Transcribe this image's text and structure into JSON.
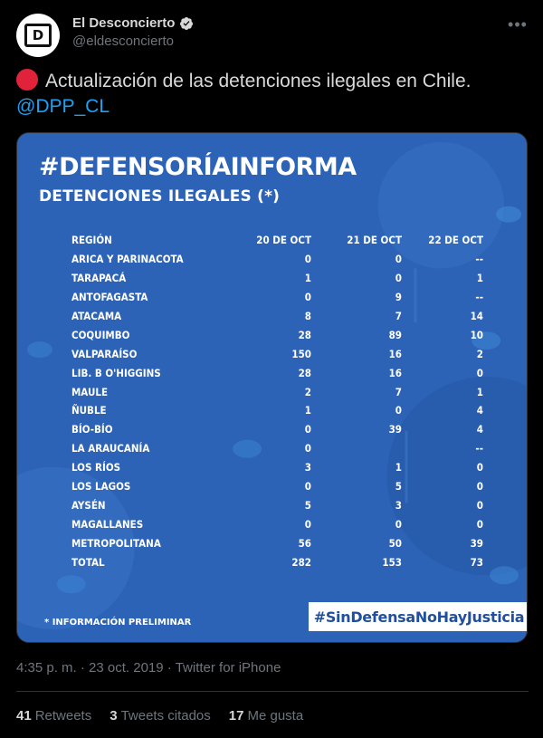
{
  "author": {
    "display_name": "El Desconcierto",
    "handle": "@eldesconcierto",
    "avatar_letter": "D"
  },
  "tweet": {
    "text": "Actualización de las detenciones ilegales en Chile.",
    "mention": "@DPP_CL"
  },
  "image": {
    "hashtag": "#DEFENSORÍAINFORMA",
    "subtitle": "DETENCIONES ILEGALES (*)",
    "columns": [
      "REGIÓN",
      "20 DE OCT",
      "21 DE OCT",
      "22 DE OCT"
    ],
    "rows": [
      [
        "ARICA Y PARINACOTA",
        "0",
        "0",
        "--"
      ],
      [
        "TARAPACÁ",
        "1",
        "0",
        "1"
      ],
      [
        "ANTOFAGASTA",
        "0",
        "9",
        "--"
      ],
      [
        "ATACAMA",
        "8",
        "7",
        "14"
      ],
      [
        "COQUIMBO",
        "28",
        "89",
        "10"
      ],
      [
        "VALPARAÍSO",
        "150",
        "16",
        "2"
      ],
      [
        "LIB. B O'HIGGINS",
        "28",
        "16",
        "0"
      ],
      [
        "MAULE",
        "2",
        "7",
        "1"
      ],
      [
        "ÑUBLE",
        "1",
        "0",
        "4"
      ],
      [
        "BÍO-BÍO",
        "0",
        "39",
        "4"
      ],
      [
        "LA ARAUCANÍA",
        "0",
        "",
        "--"
      ],
      [
        "LOS RÍOS",
        "3",
        "1",
        "0"
      ],
      [
        "LOS LAGOS",
        "0",
        "5",
        "0"
      ],
      [
        "AYSÉN",
        "5",
        "3",
        "0"
      ],
      [
        "MAGALLANES",
        "0",
        "0",
        "0"
      ],
      [
        "METROPOLITANA",
        "56",
        "50",
        "39"
      ],
      [
        "TOTAL",
        "282",
        "153",
        "73"
      ]
    ],
    "footnote": "* INFORMACIÓN PRELIMINAR",
    "campaign_hashtag": "#SinDefensaNoHayJusticia",
    "colors": {
      "background": "#2d63b6",
      "accent": "#1f4f9e"
    }
  },
  "meta": {
    "time": "4:35 p. m.",
    "date": "23 oct. 2019",
    "separator": "·",
    "source": "Twitter for iPhone"
  },
  "stats": {
    "retweets_count": "41",
    "retweets_label": "Retweets",
    "quotes_count": "3",
    "quotes_label": "Tweets citados",
    "likes_count": "17",
    "likes_label": "Me gusta"
  },
  "colors": {
    "link": "#1da1f2",
    "red_circle": "#e0233b",
    "verified": "#d9d9d9"
  },
  "icons": {
    "verified": "verified-badge-icon",
    "more": "more-options-icon",
    "red_circle": "red-circle-emoji-icon"
  }
}
